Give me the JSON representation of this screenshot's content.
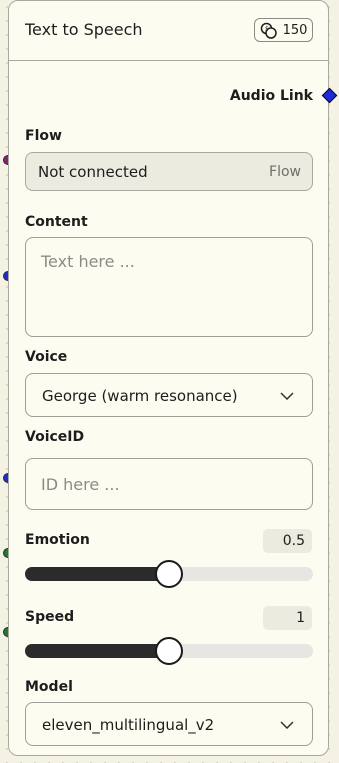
{
  "node": {
    "title": "Text to Speech",
    "cost": "150",
    "output_label": "Audio Link"
  },
  "fields": {
    "flow": {
      "label": "Flow",
      "value": "Not connected",
      "hint": "Flow"
    },
    "content": {
      "label": "Content",
      "placeholder": "Text here ..."
    },
    "voice": {
      "label": "Voice",
      "value": "George (warm resonance)"
    },
    "voice_id": {
      "label": "VoiceID",
      "placeholder": "ID here ..."
    },
    "emotion": {
      "label": "Emotion",
      "value": "0.5",
      "level": 0.5
    },
    "speed": {
      "label": "Speed",
      "value": "1",
      "level": 0.5
    },
    "model": {
      "label": "Model",
      "value": "eleven_multilingual_v2"
    }
  },
  "colors": {
    "flow_port": "#8a1c7a",
    "text_port": "#1c2cd8",
    "number_port": "#1f7a2c",
    "output_port": "#1c2cd8"
  },
  "icons": {
    "cost": "coins-icon",
    "dropdown": "chevron-down-icon"
  }
}
